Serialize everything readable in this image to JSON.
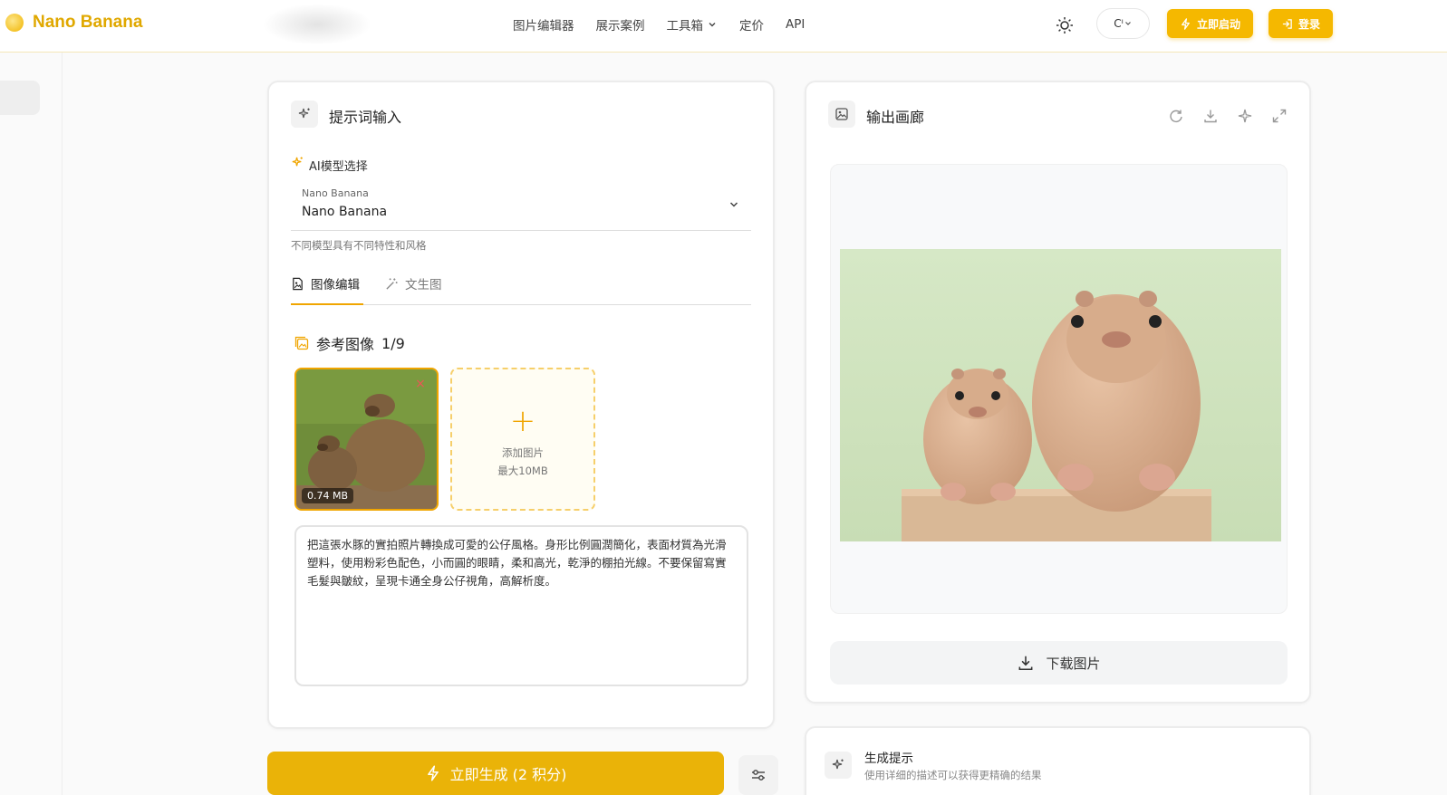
{
  "header": {
    "logo_text": "Nano Banana",
    "nav": [
      "图片编辑器",
      "展示案例",
      "工具箱",
      "定价",
      "API"
    ],
    "language": "Cᴵ",
    "start_label": "立即启动",
    "login_label": "登录",
    "accent": "#f5b800"
  },
  "editor": {
    "panel_title": "提示词输入",
    "model_section_label": "AI模型选择",
    "model_select_caption": "Nano Banana",
    "model_select_value": "Nano Banana",
    "model_help": "不同模型具有不同特性和风格",
    "tabs": [
      {
        "label": "图像编辑",
        "active": true
      },
      {
        "label": "文生图",
        "active": false
      }
    ],
    "reference_title": "参考图像",
    "reference_count": "1/9",
    "thumbnail_size": "0.74 MB",
    "add_image_label": "添加图片",
    "add_image_limit": "最大10MB",
    "prompt_text": "把這張水豚的實拍照片轉換成可愛的公仔風格。身形比例圓潤簡化，表面材質為光滑塑料，使用粉彩色配色，小而圓的眼睛，柔和高光，乾淨的棚拍光線。不要保留寫實毛髮與皺紋，呈現卡通全身公仔視角，高解析度。"
  },
  "generate": {
    "label": "立即生成 (2 积分)",
    "color": "#eab308"
  },
  "gallery": {
    "panel_title": "输出画廊",
    "download_label": "下载图片"
  },
  "hint": {
    "title": "生成提示",
    "text": "使用详细的描述可以获得更精确的结果"
  }
}
